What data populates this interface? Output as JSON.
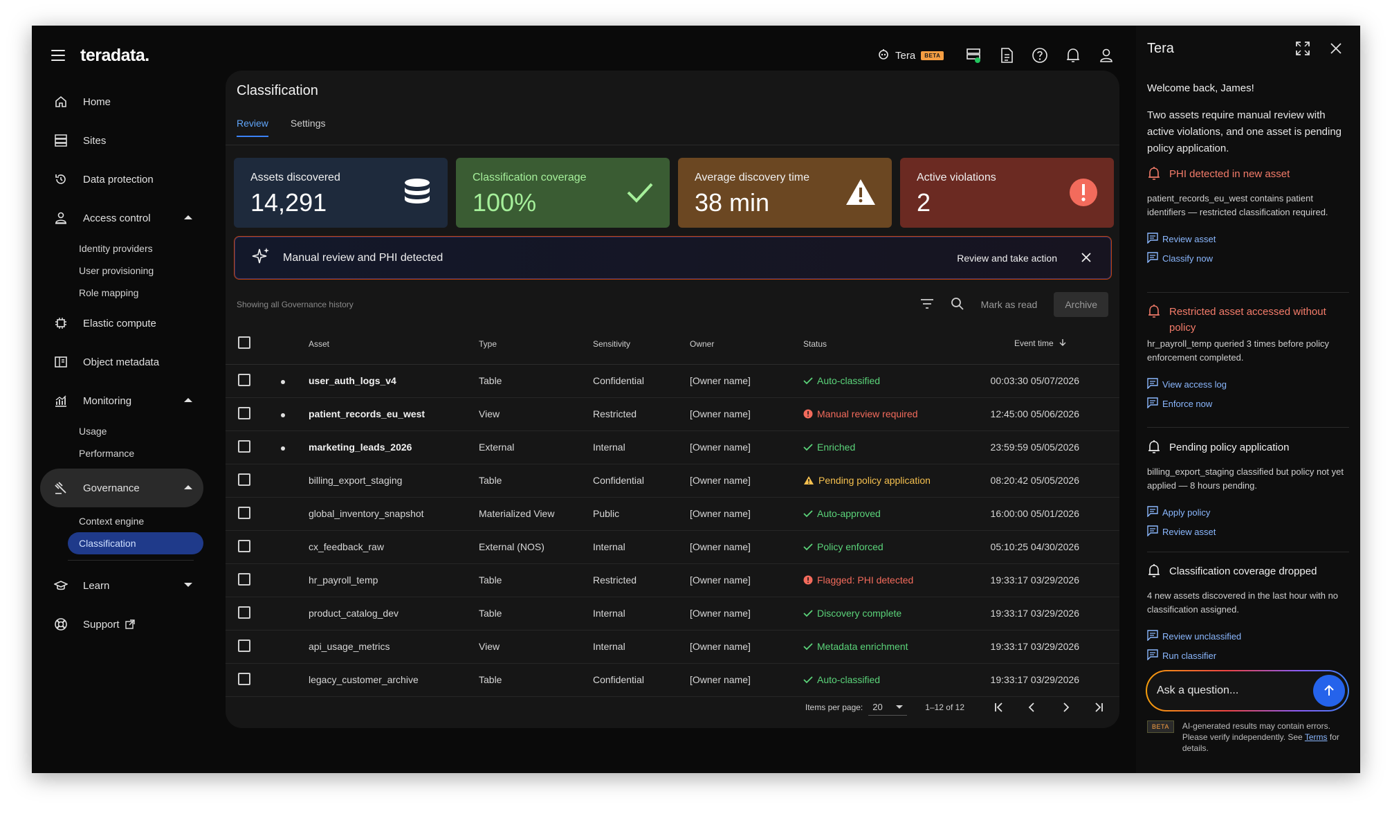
{
  "brand": "teradata.",
  "nav": {
    "home": "Home",
    "sites": "Sites",
    "data_protection": "Data protection",
    "access_control": "Access control",
    "identity_providers": "Identity providers",
    "user_provisioning": "User provisioning",
    "role_mapping": "Role mapping",
    "elastic_compute": "Elastic compute",
    "object_metadata": "Object metadata",
    "monitoring": "Monitoring",
    "usage": "Usage",
    "performance": "Performance",
    "governance": "Governance",
    "context_engine": "Context engine",
    "classification": "Classification",
    "learn": "Learn",
    "support": "Support"
  },
  "header": {
    "tera_label": "Tera",
    "beta": "BETA"
  },
  "page": {
    "title": "Classification",
    "tabs": [
      "Review",
      "Settings"
    ]
  },
  "stats": [
    {
      "label": "Assets discovered",
      "value": "14,291"
    },
    {
      "label": "Classification coverage",
      "value": "100%"
    },
    {
      "label": "Average discovery time",
      "value": "38 min"
    },
    {
      "label": "Active violations",
      "value": "2"
    }
  ],
  "banner": {
    "text": "Manual review and PHI detected",
    "action": "Review and take action"
  },
  "toolbar": {
    "showing": "Showing all Governance history",
    "mark_read": "Mark as read",
    "archive": "Archive"
  },
  "table": {
    "columns": [
      "Asset",
      "Type",
      "Sensitivity",
      "Owner",
      "Status",
      "Event time"
    ],
    "rows": [
      {
        "asset": "user_auth_logs_v4",
        "type": "Table",
        "sensitivity": "Confidential",
        "owner": "[Owner name]",
        "status": "Auto-classified",
        "time": "00:03:30 05/07/2026"
      },
      {
        "asset": "patient_records_eu_west",
        "type": "View",
        "sensitivity": "Restricted",
        "owner": "[Owner name]",
        "status": "Manual review required",
        "time": "12:45:00 05/06/2026"
      },
      {
        "asset": "marketing_leads_2026",
        "type": "External",
        "sensitivity": "Internal",
        "owner": "[Owner name]",
        "status": "Enriched",
        "time": "23:59:59 05/05/2026"
      },
      {
        "asset": "billing_export_staging",
        "type": "Table",
        "sensitivity": "Confidential",
        "owner": "[Owner name]",
        "status": "Pending policy application",
        "time": "08:20:42 05/05/2026"
      },
      {
        "asset": "global_inventory_snapshot",
        "type": "Materialized View",
        "sensitivity": "Public",
        "owner": "[Owner name]",
        "status": "Auto-approved",
        "time": "16:00:00 05/01/2026"
      },
      {
        "asset": "cx_feedback_raw",
        "type": "External (NOS)",
        "sensitivity": "Internal",
        "owner": "[Owner name]",
        "status": "Policy enforced",
        "time": "05:10:25 04/30/2026"
      },
      {
        "asset": "hr_payroll_temp",
        "type": "Table",
        "sensitivity": "Restricted",
        "owner": "[Owner name]",
        "status": "Flagged: PHI detected",
        "time": "19:33:17 03/29/2026"
      },
      {
        "asset": "product_catalog_dev",
        "type": "Table",
        "sensitivity": "Internal",
        "owner": "[Owner name]",
        "status": "Discovery complete",
        "time": "19:33:17 03/29/2026"
      },
      {
        "asset": "api_usage_metrics",
        "type": "View",
        "sensitivity": "Internal",
        "owner": "[Owner name]",
        "status": "Metadata enrichment",
        "time": "19:33:17 03/29/2026"
      },
      {
        "asset": "legacy_customer_archive",
        "type": "Table",
        "sensitivity": "Confidential",
        "owner": "[Owner name]",
        "status": "Auto-classified",
        "time": "19:33:17 03/29/2026"
      }
    ]
  },
  "pager": {
    "label": "Items per page:",
    "per_page": "20",
    "range": "1–12 of 12"
  },
  "panel": {
    "title": "Tera",
    "welcome": "Welcome back, James!",
    "intro": "Two assets require manual review with active violations, and one asset is pending policy application.",
    "alerts": [
      {
        "title": "PHI detected in new asset",
        "desc": "patient_records_eu_west contains patient identifiers — restricted classification required.",
        "links": [
          "Review asset",
          "Classify now"
        ]
      },
      {
        "title": "Restricted asset accessed without policy",
        "desc": "hr_payroll_temp queried 3 times before policy enforcement completed.",
        "links": [
          "View access log",
          "Enforce now"
        ]
      },
      {
        "title": "Pending policy application",
        "desc": "billing_export_staging classified but policy not yet applied — 8 hours pending.",
        "links": [
          "Apply policy",
          "Review asset"
        ]
      },
      {
        "title": "Classification coverage dropped",
        "desc": "4 new assets discovered in the last hour with no classification assigned.",
        "links": [
          "Review unclassified",
          "Run classifier"
        ]
      }
    ],
    "ask_placeholder": "Ask a question...",
    "beta": "BETA",
    "disclaimer_a": "AI-generated results may contain errors. Please verify independently. See ",
    "terms": "Terms",
    "disclaimer_b": " for details."
  },
  "colors": {
    "accent": "#3b82f6",
    "success": "#5bd47a",
    "danger": "#f36b5c",
    "warning": "#f5c04f"
  }
}
